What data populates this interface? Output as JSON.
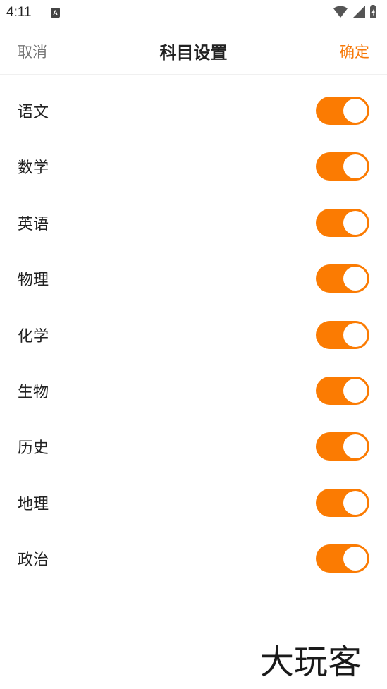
{
  "status_bar": {
    "time": "4:11",
    "notification_icon": "a-icon",
    "notification_letter": "A",
    "icons": [
      "wifi-icon",
      "signal-icon",
      "battery-charging-icon"
    ]
  },
  "header": {
    "cancel_label": "取消",
    "title": "科目设置",
    "confirm_label": "确定"
  },
  "subjects": [
    {
      "label": "语文",
      "enabled": true
    },
    {
      "label": "数学",
      "enabled": true
    },
    {
      "label": "英语",
      "enabled": true
    },
    {
      "label": "物理",
      "enabled": true
    },
    {
      "label": "化学",
      "enabled": true
    },
    {
      "label": "生物",
      "enabled": true
    },
    {
      "label": "历史",
      "enabled": true
    },
    {
      "label": "地理",
      "enabled": true
    },
    {
      "label": "政治",
      "enabled": true
    }
  ],
  "colors": {
    "accent": "#f77908",
    "toggle_on": "#fb7b02",
    "cancel_text": "#777777"
  },
  "watermark": {
    "text": "大玩客"
  }
}
